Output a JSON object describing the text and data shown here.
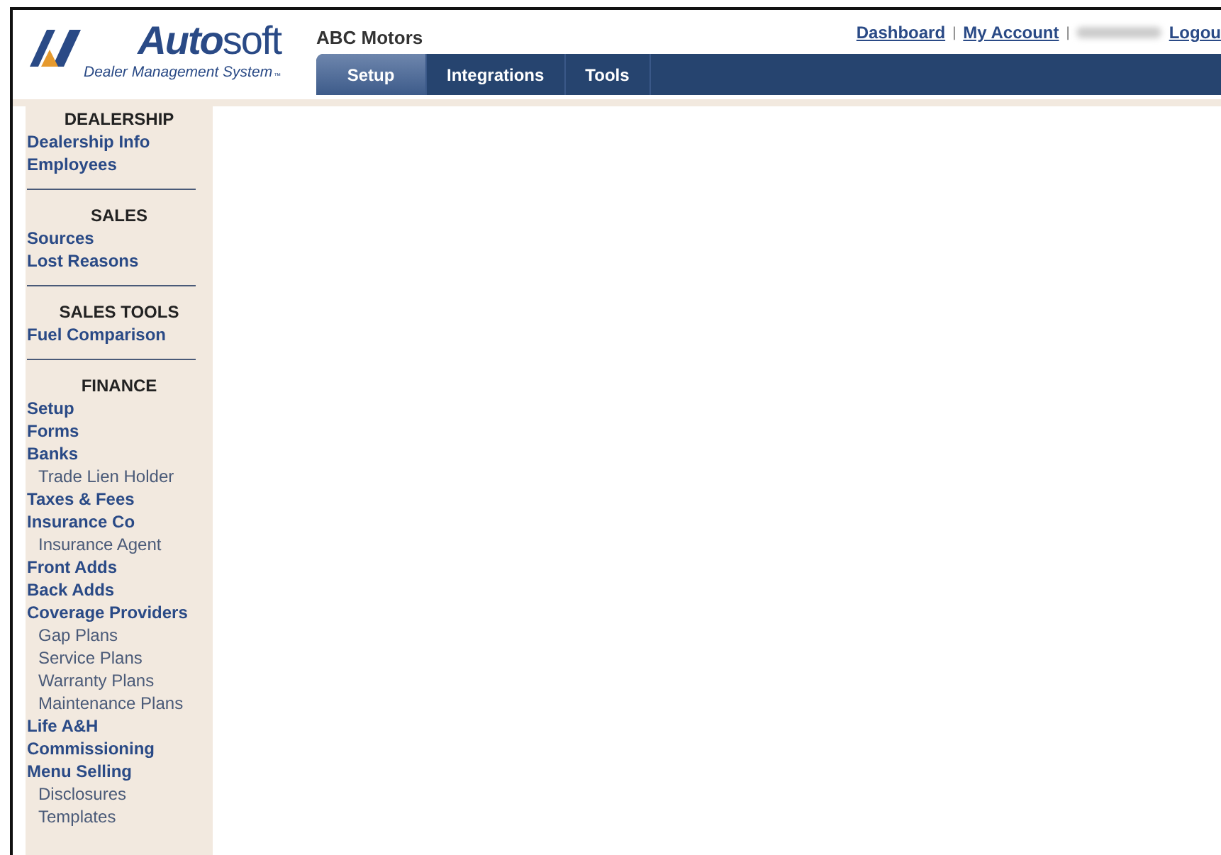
{
  "logo": {
    "bold": "Auto",
    "light": "soft",
    "tagline": "Dealer Management System",
    "mark": "™"
  },
  "header": {
    "title": "ABC Motors",
    "links": [
      {
        "label": "Dashboard",
        "kind": "link"
      },
      {
        "label": "|",
        "kind": "separator"
      },
      {
        "label": "My Account",
        "kind": "link"
      },
      {
        "label": "|",
        "kind": "separator"
      },
      {
        "kind": "redacted"
      },
      {
        "label": "Logou",
        "kind": "link"
      }
    ]
  },
  "tabs": [
    {
      "label": "Setup",
      "selected": true
    },
    {
      "label": "Integrations",
      "selected": false
    },
    {
      "label": "Tools",
      "selected": false
    }
  ],
  "sidebar": {
    "sections": [
      {
        "heading": "DEALERSHIP",
        "items": [
          {
            "label": "Dealership Info"
          },
          {
            "label": "Employees"
          }
        ]
      },
      {
        "heading": "SALES",
        "items": [
          {
            "label": "Sources"
          },
          {
            "label": "Lost Reasons"
          }
        ]
      },
      {
        "heading": "SALES TOOLS",
        "items": [
          {
            "label": "Fuel Comparison"
          }
        ]
      },
      {
        "heading": "FINANCE",
        "items": [
          {
            "label": "Setup"
          },
          {
            "label": "Forms"
          },
          {
            "label": "Banks",
            "children": [
              {
                "label": "Trade Lien Holder"
              }
            ]
          },
          {
            "label": "Taxes & Fees"
          },
          {
            "label": "Insurance Co",
            "children": [
              {
                "label": "Insurance Agent"
              }
            ]
          },
          {
            "label": "Front Adds"
          },
          {
            "label": "Back Adds"
          },
          {
            "label": "Coverage Providers",
            "children": [
              {
                "label": "Gap Plans"
              },
              {
                "label": "Service Plans"
              },
              {
                "label": "Warranty Plans"
              },
              {
                "label": "Maintenance Plans"
              }
            ]
          },
          {
            "label": "Life A&H"
          },
          {
            "label": "Commissioning"
          },
          {
            "label": "Menu Selling",
            "children": [
              {
                "label": "Disclosures"
              },
              {
                "label": "Templates"
              }
            ]
          }
        ]
      }
    ]
  }
}
